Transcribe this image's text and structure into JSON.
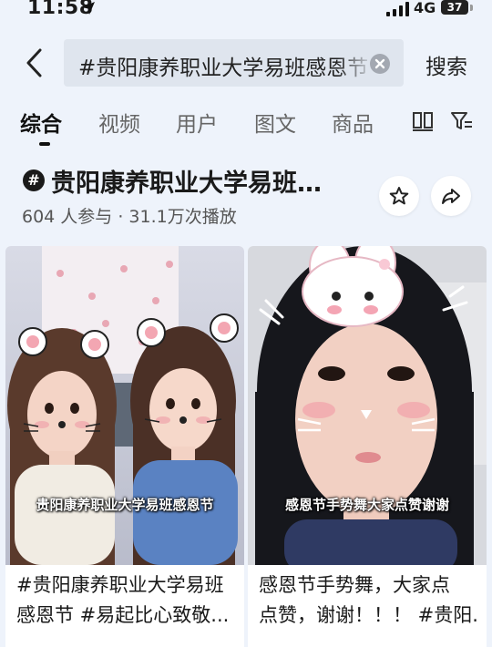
{
  "status_bar": {
    "time": "11:58",
    "network": "4G",
    "battery": "37",
    "icons": [
      "location-arrow-icon",
      "signal-bars-icon",
      "battery-icon"
    ]
  },
  "search": {
    "query": "#贵阳康养职业大学易班感恩节",
    "button_label": "搜索",
    "icons": [
      "back-chevron-icon",
      "clear-icon"
    ]
  },
  "tabs": [
    {
      "label": "综合",
      "active": true
    },
    {
      "label": "视频",
      "active": false
    },
    {
      "label": "用户",
      "active": false
    },
    {
      "label": "图文",
      "active": false
    },
    {
      "label": "商品",
      "active": false
    }
  ],
  "tab_icons": [
    "book-icon",
    "filter-icon"
  ],
  "topic": {
    "title": "贵阳康养职业大学易班…",
    "stats": "604 人参与 · 31.1万次播放",
    "icons": [
      "star-icon",
      "share-icon"
    ]
  },
  "results": [
    {
      "overlay": "贵阳康养职业大学易班感恩节",
      "caption_lines": [
        "#贵阳康养职业大学易班",
        "感恩节 #易起比心致敬..."
      ]
    },
    {
      "overlay": "感恩节手势舞大家点赞谢谢",
      "caption_lines": [
        "感恩节手势舞，大家点",
        "点赞，谢谢！！！ #贵阳..."
      ]
    }
  ],
  "colors": {
    "background": "#eef3fb",
    "search_box": "#dfe5ee",
    "text": "#1a1a1a"
  }
}
